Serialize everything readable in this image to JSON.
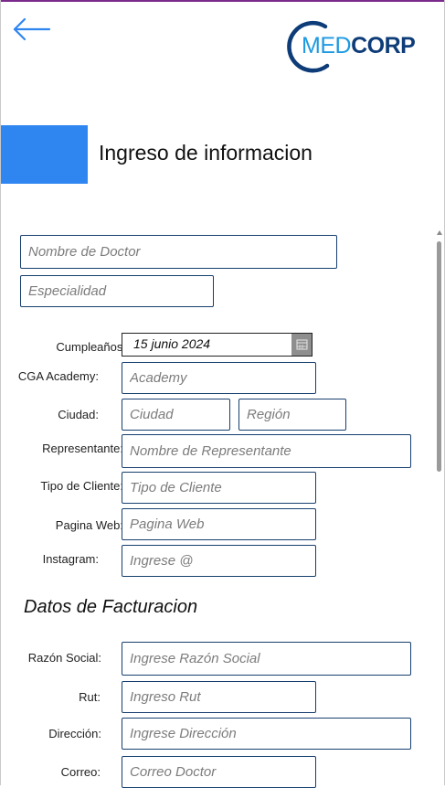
{
  "header": {
    "logo_med": "MED",
    "logo_corp": "CORP",
    "title": "Ingreso de informacion"
  },
  "colors": {
    "accent": "#2f86f0",
    "brand_light": "#1e9ae0",
    "brand_dark": "#0d3c78",
    "field_border": "#173f6e"
  },
  "icons": {
    "back": "back-arrow-icon",
    "calendar": "calendar-icon"
  },
  "doctor": {
    "name_placeholder": "Nombre de Doctor",
    "specialty_placeholder": "Especialidad"
  },
  "form": {
    "birthday_label": "Cumpleaños:",
    "birthday_value": "15 junio 2024",
    "academy_label": "CGA Academy:",
    "academy_placeholder": "Academy",
    "city_label": "Ciudad:",
    "city_placeholder": "Ciudad",
    "region_placeholder": "Región",
    "rep_label": "Representante:",
    "rep_placeholder": "Nombre de Representante",
    "client_type_label": "Tipo de Cliente:",
    "client_type_placeholder": "Tipo de Cliente",
    "web_label": "Pagina Web:",
    "web_placeholder": "Pagina Web",
    "instagram_label": "Instagram:",
    "instagram_placeholder": "Ingrese @"
  },
  "billing": {
    "section_title": "Datos de Facturacion",
    "social_label": "Razón Social:",
    "social_placeholder": "Ingrese Razón Social",
    "rut_label": "Rut:",
    "rut_placeholder": "Ingreso Rut",
    "address_label": "Dirección:",
    "address_placeholder": "Ingrese Dirección",
    "email_label": "Correo:",
    "email_placeholder": "Correo Doctor"
  }
}
